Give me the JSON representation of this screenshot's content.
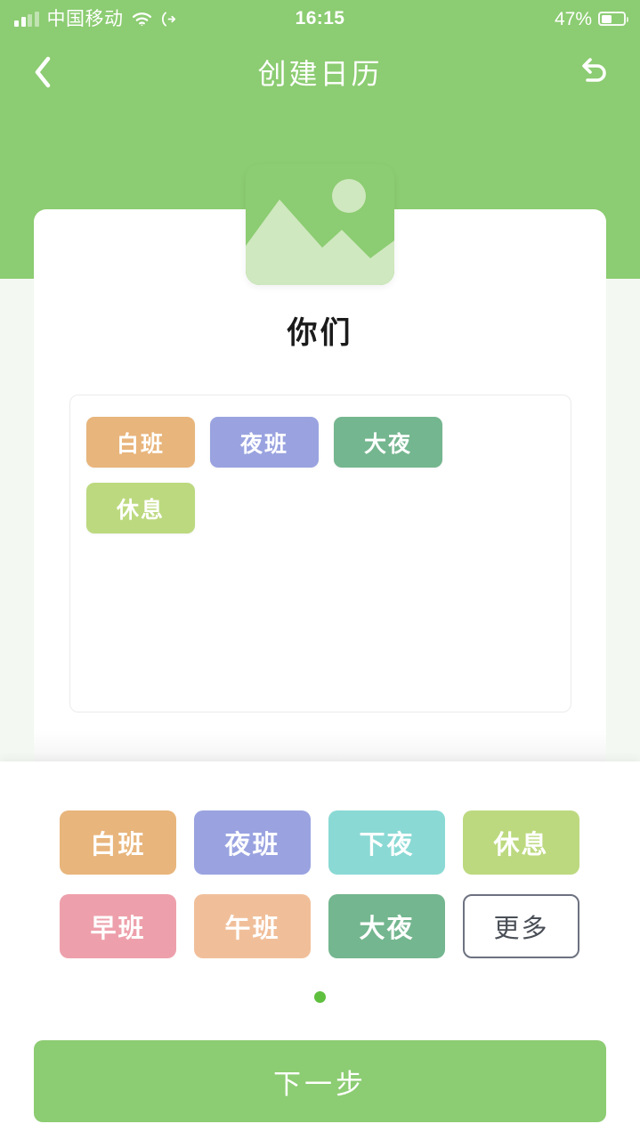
{
  "status_bar": {
    "carrier": "中国移动",
    "time": "16:15",
    "battery_percent": "47%",
    "wifi_icon": "wifi-icon",
    "location_icon": "location-arrow-icon",
    "signal_icon": "signal-bars-icon",
    "battery_icon": "battery-icon"
  },
  "nav": {
    "title": "创建日历",
    "back_icon": "chevron-left-icon",
    "reset_icon": "undo-arrow-icon"
  },
  "calendar": {
    "avatar_icon": "image-placeholder-icon",
    "name": "你们"
  },
  "selected_shifts": [
    {
      "label": "白班",
      "color": "#e8b57c"
    },
    {
      "label": "夜班",
      "color": "#9aa3e0"
    },
    {
      "label": "大夜",
      "color": "#74b68f"
    },
    {
      "label": "休息",
      "color": "#bcd97f"
    }
  ],
  "palette": {
    "shifts": [
      {
        "label": "白班",
        "color": "#e8b57c",
        "outlined": false
      },
      {
        "label": "夜班",
        "color": "#9aa3e0",
        "outlined": false
      },
      {
        "label": "下夜",
        "color": "#8ad9d4",
        "outlined": false
      },
      {
        "label": "休息",
        "color": "#bcd97f",
        "outlined": false
      },
      {
        "label": "早班",
        "color": "#eda0ab",
        "outlined": false
      },
      {
        "label": "午班",
        "color": "#f0bf9a",
        "outlined": false
      },
      {
        "label": "大夜",
        "color": "#74b68f",
        "outlined": false
      },
      {
        "label": "更多",
        "color": "#ffffff",
        "outlined": true
      }
    ],
    "pages": 1,
    "active_page": 0
  },
  "footer": {
    "next_label": "下一步"
  },
  "theme": {
    "brand_green": "#8ccc72",
    "dot_green": "#5fbf3e",
    "page_bg": "#f3f8f2"
  }
}
